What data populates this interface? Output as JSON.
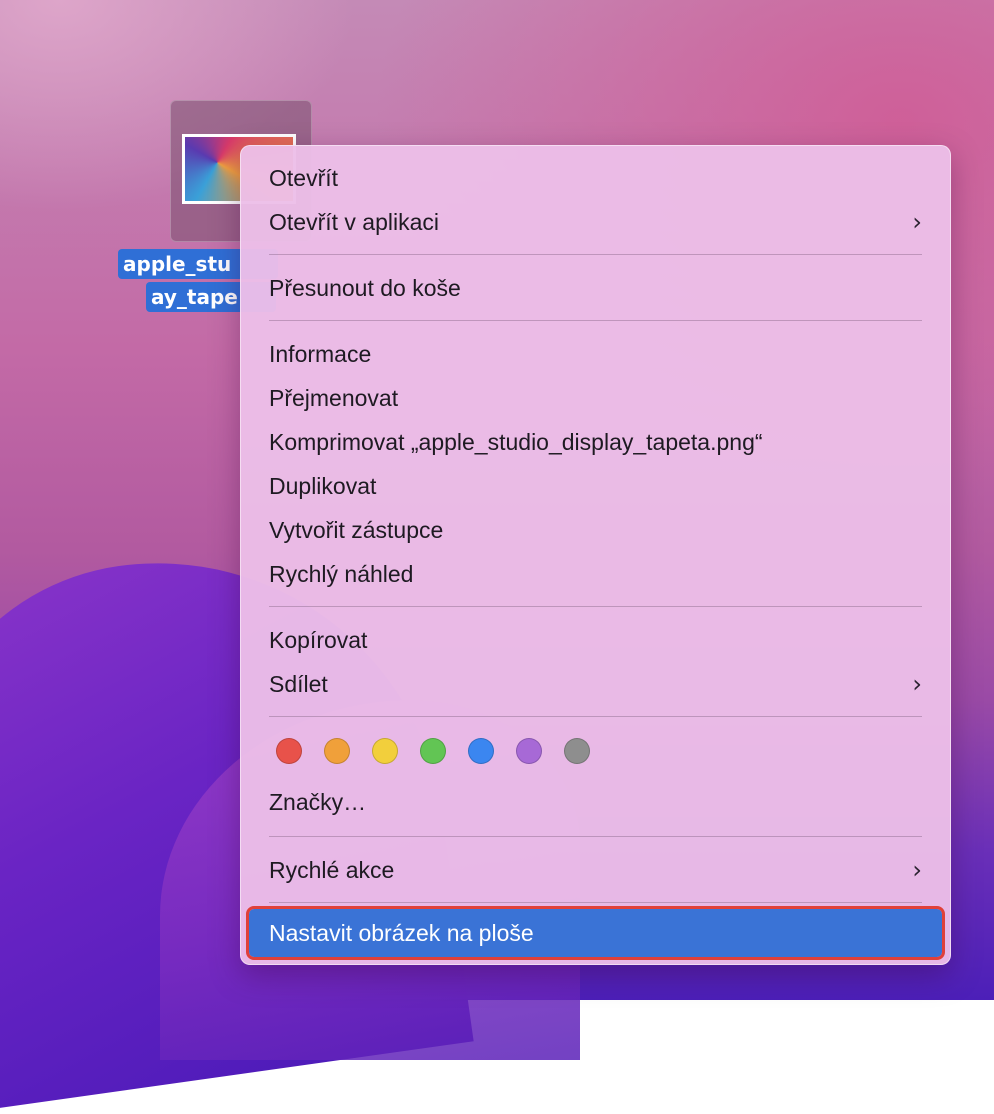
{
  "desktop_file": {
    "label_line1": "apple_stu",
    "label_line2": "ay_tape"
  },
  "menu": {
    "open": "Otevřít",
    "open_with": "Otevřít v aplikaci",
    "move_to_trash": "Přesunout do koše",
    "get_info": "Informace",
    "rename": "Přejmenovat",
    "compress": "Komprimovat „apple_studio_display_tapeta.png“",
    "duplicate": "Duplikovat",
    "make_alias": "Vytvořit zástupce",
    "quick_look": "Rychlý náhled",
    "copy": "Kopírovat",
    "share": "Sdílet",
    "tags_label": "Značky…",
    "quick_actions": "Rychlé akce",
    "set_desktop_picture": "Nastavit obrázek na ploše",
    "submenu_chevron": "›"
  },
  "tag_colors": {
    "red": "#e8524a",
    "orange": "#f0a03a",
    "yellow": "#f2cf3c",
    "green": "#62c554",
    "blue": "#3b86f0",
    "purple": "#a769d6",
    "gray": "#8e8e8e"
  },
  "colors": {
    "highlight": "#3a73d6",
    "highlight_border": "#e0403a"
  }
}
